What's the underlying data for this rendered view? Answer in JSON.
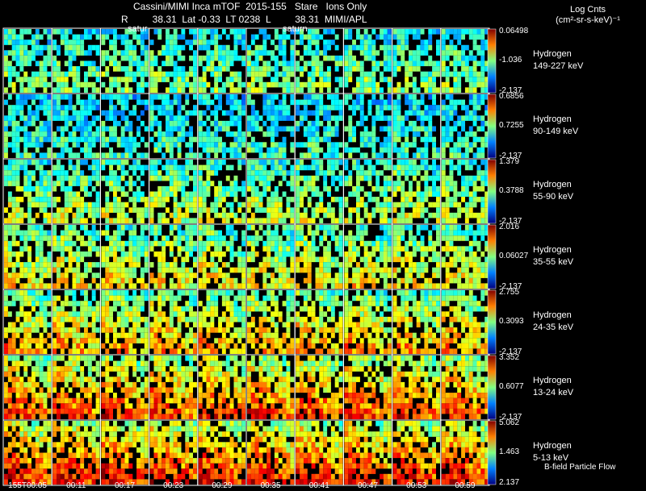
{
  "header": {
    "title": "Cassini/MIMI Inca mTOF  2015-155   Stare   Ions Only",
    "line2": "R         38.31  Lat -0.33  LT 0238  L         38.31  MIMI/APL",
    "saturn_1": "satur",
    "saturn_2": "saturn"
  },
  "legend": {
    "title_line1": "Log Cnts",
    "title_line2": "(cm²-sr-s-keV)⁻¹"
  },
  "note": "B-field Particle Flow",
  "chart_data": {
    "type": "heatmap",
    "times": [
      "155T00:05",
      "00:11",
      "00:17",
      "00:23",
      "00:29",
      "00:35",
      "00:41",
      "00:47",
      "00:53",
      "00:59"
    ],
    "rows": [
      {
        "species": "Hydrogen",
        "energy": "149-227 keV",
        "cmax": "0.06498",
        "cmid": "-1.036",
        "cmin": "-2.137",
        "intensity": 0.25
      },
      {
        "species": "Hydrogen",
        "energy": "90-149 keV",
        "cmax": "0.6856",
        "cmid": "0.7255",
        "cmin": "-2.137",
        "intensity": 0.18
      },
      {
        "species": "Hydrogen",
        "energy": "55-90 keV",
        "cmax": "1.379",
        "cmid": "0.3788",
        "cmin": "-2.137",
        "intensity": 0.32
      },
      {
        "species": "Hydrogen",
        "energy": "35-55 keV",
        "cmax": "2.016",
        "cmid": "0.06027",
        "cmin": "-2.137",
        "intensity": 0.38
      },
      {
        "species": "Hydrogen",
        "energy": "24-35 keV",
        "cmax": "2.755",
        "cmid": "0.3093",
        "cmin": "-2.137",
        "intensity": 0.45
      },
      {
        "species": "Hydrogen",
        "energy": "13-24 keV",
        "cmax": "3.352",
        "cmid": "0.6077",
        "cmin": "-2.137",
        "intensity": 0.55
      },
      {
        "species": "Hydrogen",
        "energy": "5-13 keV",
        "cmax": "5.062",
        "cmid": "1.463",
        "cmin": "2.137",
        "intensity": 0.6
      }
    ]
  }
}
